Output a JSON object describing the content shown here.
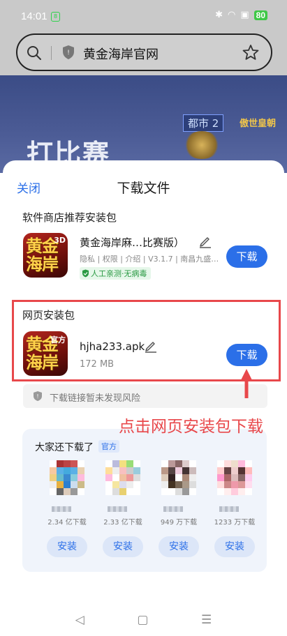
{
  "status_bar": {
    "time": "14:01",
    "battery": "80"
  },
  "address_bar": {
    "title": "黄金海岸官网"
  },
  "banner": {
    "headline": "打比赛",
    "tag_city": "都市 2",
    "tag_brand": "傲世皇朝"
  },
  "sheet": {
    "close_label": "关闭",
    "title": "下载文件",
    "store_section": {
      "title": "软件商店推荐安装包",
      "app_name": "黄金海岸麻…比赛版）",
      "meta": "隐私 | 权限 | 介绍 | V3.1.7 | 南昌九盛…",
      "badge": "人工亲测·无病毒",
      "download_label": "下载"
    },
    "web_section": {
      "title": "网页安装包",
      "file_name": "hjha233.apk",
      "size": "172 MB",
      "download_label": "下载"
    },
    "risk_text": "下载链接暂未发现风险",
    "hint": "点击网页安装包下载",
    "also_downloaded": {
      "title": "大家还下载了",
      "tag": "官方",
      "items": [
        {
          "count": "2.34 亿下载",
          "install_label": "安装"
        },
        {
          "count": "2.33 亿下载",
          "install_label": "安装"
        },
        {
          "count": "949 万下载",
          "install_label": "安装"
        },
        {
          "count": "1233 万下载",
          "install_label": "安装"
        }
      ]
    }
  },
  "icons": {
    "search": "search-icon",
    "shield": "shield-icon",
    "star": "star-icon",
    "edit": "edit-icon",
    "back": "back-icon",
    "home": "home-icon",
    "menu": "menu-icon"
  },
  "colors": {
    "accent": "#2b6fe8",
    "highlight": "#e8484b",
    "safe": "#2a9a43"
  }
}
